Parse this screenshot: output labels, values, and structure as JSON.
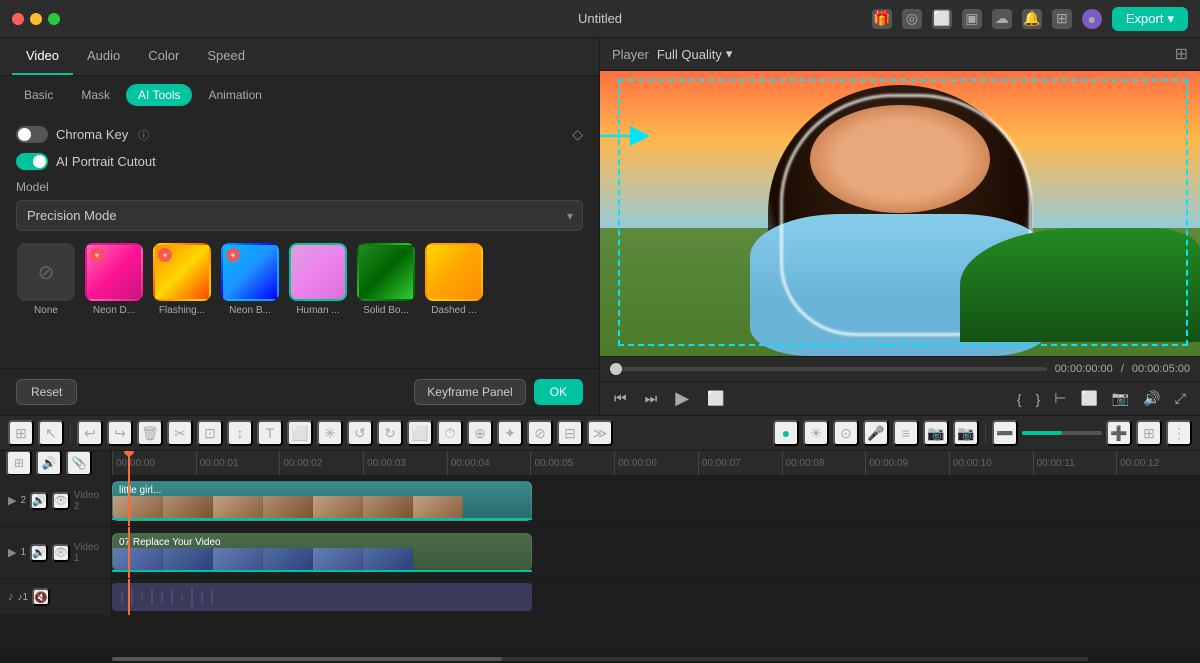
{
  "app": {
    "title": "Untitled",
    "export_label": "Export"
  },
  "titlebar": {
    "icons": [
      "gift-icon",
      "profile-icon",
      "notifications-icon",
      "download-icon",
      "bell-icon",
      "apps-icon",
      "avatar-icon"
    ],
    "grid_icon": "⊞"
  },
  "video_tabs": [
    {
      "id": "video",
      "label": "Video",
      "active": true
    },
    {
      "id": "audio",
      "label": "Audio",
      "active": false
    },
    {
      "id": "color",
      "label": "Color",
      "active": false
    },
    {
      "id": "speed",
      "label": "Speed",
      "active": false
    }
  ],
  "sub_tabs": [
    {
      "id": "basic",
      "label": "Basic",
      "active": false
    },
    {
      "id": "mask",
      "label": "Mask",
      "active": false
    },
    {
      "id": "ai_tools",
      "label": "AI Tools",
      "active": true
    },
    {
      "id": "animation",
      "label": "Animation",
      "active": false
    }
  ],
  "chroma_key": {
    "label": "Chroma Key",
    "enabled": false,
    "help_icon": "?"
  },
  "ai_portrait": {
    "label": "AI Portrait Cutout",
    "enabled": true
  },
  "model": {
    "label": "Model",
    "value": "Precision Mode"
  },
  "effects": [
    {
      "id": "none",
      "label": "None",
      "style": "none",
      "selected": false
    },
    {
      "id": "neon1",
      "label": "Neon D...",
      "style": "neon1",
      "selected": false,
      "heart": true
    },
    {
      "id": "neon2",
      "label": "Flashing...",
      "style": "neon2",
      "selected": false,
      "heart": true
    },
    {
      "id": "neon3",
      "label": "Neon B...",
      "style": "neon3",
      "selected": false,
      "heart": true
    },
    {
      "id": "human",
      "label": "Human ...",
      "style": "human",
      "selected": true,
      "heart": false
    },
    {
      "id": "solid",
      "label": "Solid Bo...",
      "style": "solid",
      "selected": false,
      "heart": false
    },
    {
      "id": "dashed",
      "label": "Dashed ...",
      "style": "dashed",
      "selected": false,
      "heart": false
    }
  ],
  "footer": {
    "reset_label": "Reset",
    "keyframe_label": "Keyframe Panel",
    "ok_label": "OK"
  },
  "player": {
    "label": "Player",
    "quality": "Full Quality",
    "time_current": "00:00:00:00",
    "time_total": "00:00:05:00"
  },
  "timeline": {
    "ruler_marks": [
      "00:00:00",
      "00:00:01",
      "00:00:02",
      "00:00:03",
      "00:00:04",
      "00:00:05",
      "00:00:06",
      "00:00:07",
      "00:00:08",
      "00:00:09",
      "00:00:10",
      "00:00:11",
      "00:00:12"
    ],
    "tracks": [
      {
        "id": "v2",
        "label": "Video 2",
        "icon": "▶",
        "clip_title": "little girl..."
      },
      {
        "id": "v1",
        "label": "Video 1",
        "clip_title": "07 Replace Your Video"
      },
      {
        "id": "a1",
        "label": "♪1",
        "type": "audio"
      }
    ]
  },
  "toolbar": {
    "tools": [
      "⊞",
      "✂",
      "↩",
      "↪",
      "🗑",
      "✂",
      "⊡",
      "↕",
      "T",
      "⬜",
      "✳",
      "↻",
      "↻",
      "⬜",
      "⏱",
      "⊕",
      "✦",
      "⊘"
    ],
    "right_tools": [
      "●",
      "☀",
      "⊙",
      "🎤",
      "≡",
      "📷",
      "📷",
      "➖",
      "—",
      "➕",
      "⊞"
    ]
  }
}
